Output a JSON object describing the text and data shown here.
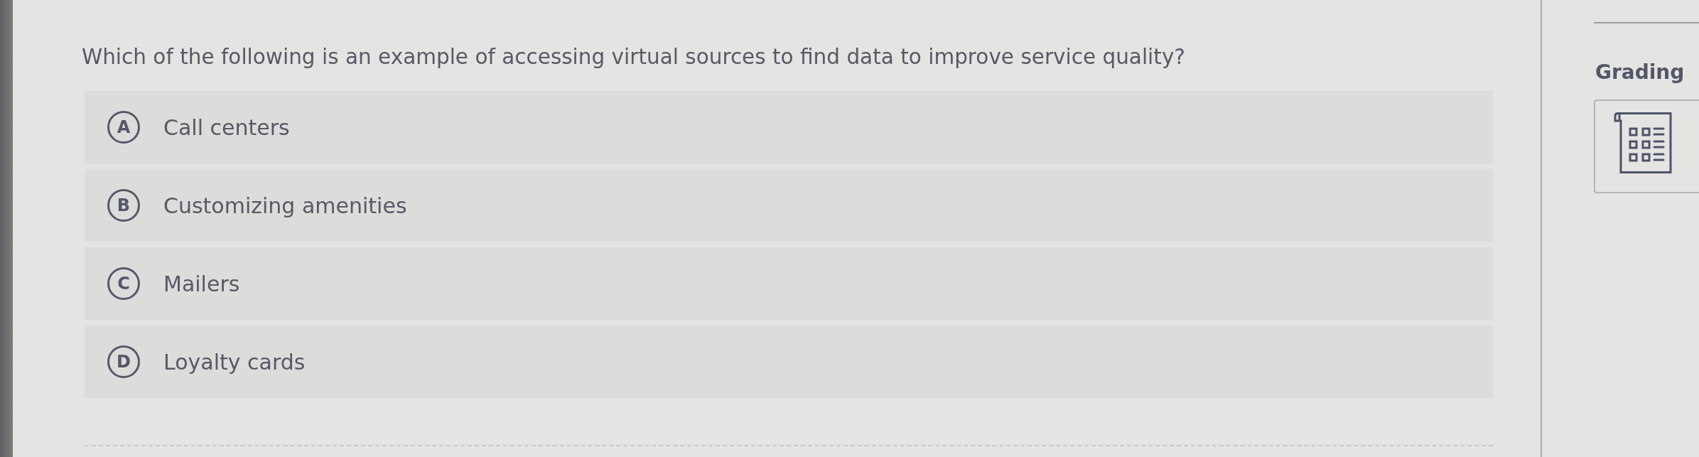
{
  "question": {
    "text": "Which of the following is an example of accessing virtual sources to find data to improve service quality?"
  },
  "options": [
    {
      "letter": "A",
      "text": "Call centers",
      "selected": false
    },
    {
      "letter": "B",
      "text": "Customizing amenities",
      "selected": false
    },
    {
      "letter": "C",
      "text": "Mailers",
      "selected": false
    },
    {
      "letter": "D",
      "text": "Loyalty cards",
      "selected": false
    }
  ],
  "sidebar": {
    "heading": "Grading"
  }
}
